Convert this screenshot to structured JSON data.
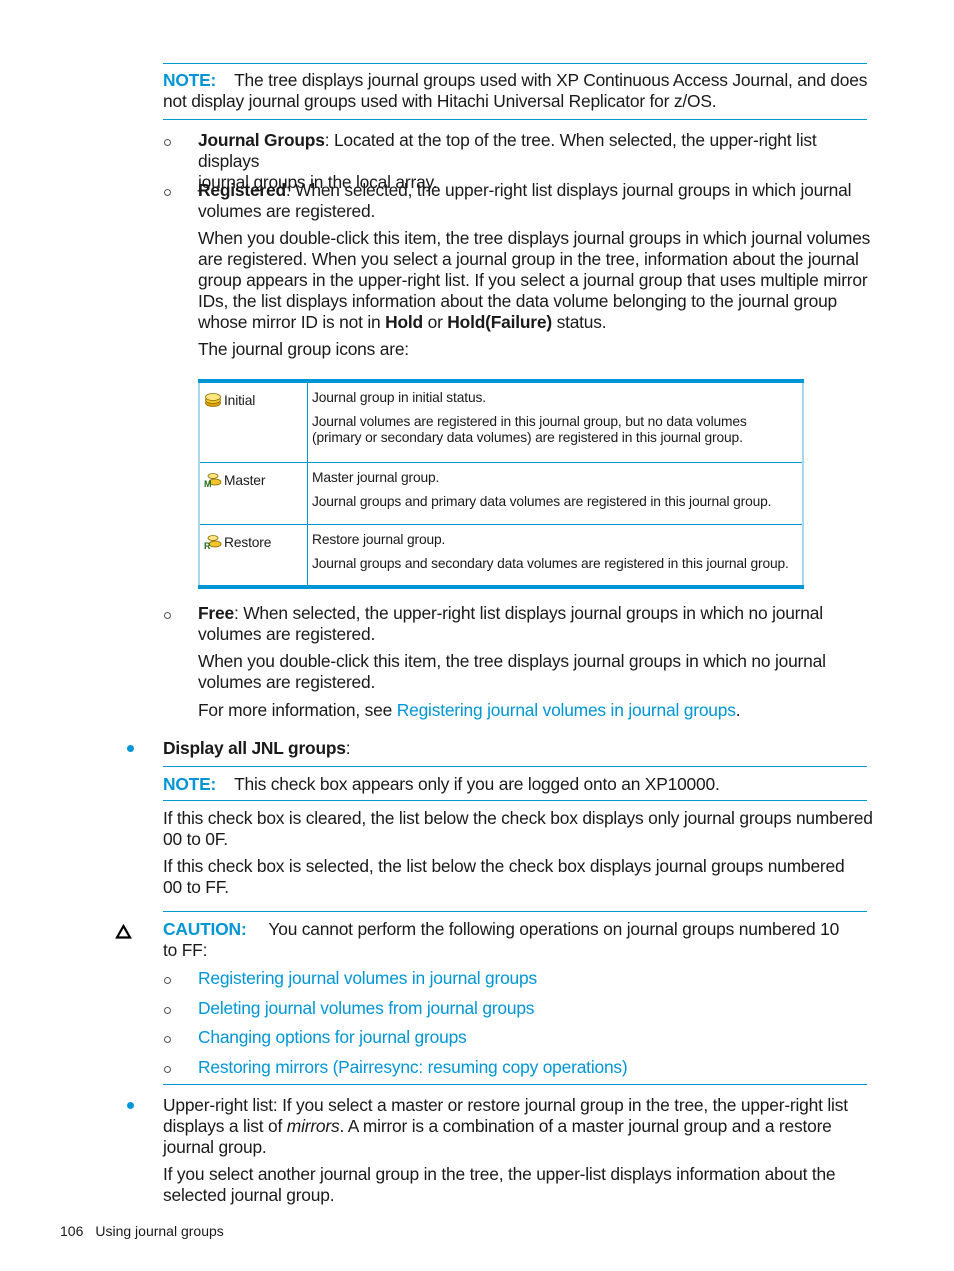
{
  "note1": {
    "label": "NOTE:",
    "text": "The tree displays journal groups used with XP Continuous Access Journal, and does",
    "text2": "not display journal groups used with Hitachi Universal Replicator for z/OS."
  },
  "tree_items": {
    "journal_groups": {
      "term": "Journal Groups",
      "line1": ": Located at the top of the tree. When selected, the upper-right list displays",
      "line2": "journal groups in the local array."
    },
    "registered": {
      "term": "Registered",
      "line1": ": When selected, the upper-right list displays journal groups in which journal",
      "line2": "volumes are registered.",
      "para_lines": [
        "When you double-click this item, the tree displays journal groups in which journal volumes",
        "are registered. When you select a journal group in the tree, information about the journal",
        "group appears in the upper-right list. If you select a journal group that uses multiple mirror",
        "IDs, the list displays information about the data volume belonging to the journal group"
      ],
      "last_line_pre": "whose mirror ID is not in ",
      "hold": "Hold",
      "or": " or ",
      "hold_failure": "Hold(Failure)",
      "last_line_post": " status.",
      "icons_intro": "The journal group icons are:"
    },
    "free": {
      "term": "Free",
      "line1": ": When selected, the upper-right list displays journal groups in which no journal",
      "line2": "volumes are registered.",
      "para_line1": "When you double-click this item, the tree displays journal groups in which no journal",
      "para_line2": "volumes are registered.",
      "more_pre": "For more information, see ",
      "more_link": "Registering journal volumes in journal groups",
      "more_post": "."
    }
  },
  "icon_table": {
    "rows": [
      {
        "icon": "journal-group-initial-icon",
        "label": "Initial",
        "desc1": "Journal group in initial status.",
        "desc2": "Journal volumes are registered in this journal group, but no data volumes (primary or secondary data volumes) are registered in this journal group."
      },
      {
        "icon": "journal-group-master-icon",
        "label": "Master",
        "desc1": "Master journal group.",
        "desc2": "Journal groups and primary data volumes are registered in this journal group."
      },
      {
        "icon": "journal-group-restore-icon",
        "label": "Restore",
        "desc1": "Restore journal group.",
        "desc2": "Journal groups and secondary data volumes are registered in this journal group."
      }
    ]
  },
  "display_all": {
    "term": "Display all JNL groups",
    "colon": ":",
    "note_label": "NOTE:",
    "note_text": "This check box appears only if you are logged onto an XP10000.",
    "cleared_line1": "If this check box is cleared, the list below the check box displays only journal groups numbered",
    "cleared_line2": "00 to 0F.",
    "selected_line1": "If this check box is selected, the list below the check box displays journal groups numbered",
    "selected_line2": "00 to FF."
  },
  "caution": {
    "icon": "caution-triangle-icon",
    "label": "CAUTION:",
    "text": "You cannot perform the following operations on journal groups numbered 10",
    "text2": "to FF:",
    "links": [
      "Registering journal volumes in journal groups",
      "Deleting journal volumes from journal groups",
      "Changing options for journal groups",
      "Restoring mirrors (Pairresync: resuming copy operations)"
    ]
  },
  "upper_right": {
    "line1": "Upper-right list: If you select a master or restore journal group in the tree, the upper-right list",
    "line2_pre": "displays a list of ",
    "line2_em": "mirrors",
    "line2_post": ". A mirror is a combination of a master journal group and a restore",
    "line3": "journal group.",
    "para_line1": "If you select another journal group in the tree, the upper-list displays information about the",
    "para_line2": "selected journal group."
  },
  "footer": {
    "page_number": "106",
    "section": "Using journal groups"
  },
  "colors": {
    "accent": "#0096d6",
    "text": "#1a1a1a"
  }
}
